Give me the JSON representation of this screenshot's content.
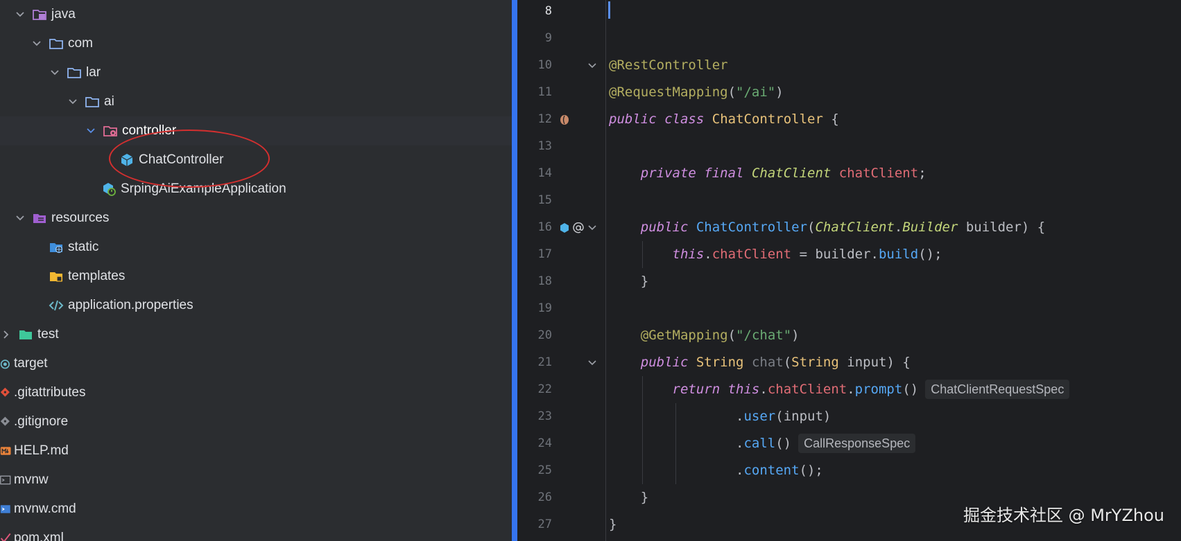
{
  "tree": {
    "items": [
      {
        "label": "java",
        "icon": "java-source-folder-icon",
        "expanded": true
      },
      {
        "label": "com",
        "icon": "package-folder-icon",
        "expanded": true
      },
      {
        "label": "lar",
        "icon": "package-folder-icon",
        "expanded": true
      },
      {
        "label": "ai",
        "icon": "package-folder-icon",
        "expanded": true
      },
      {
        "label": "controller",
        "icon": "controller-package-icon",
        "expanded": true
      },
      {
        "label": "ChatController",
        "icon": "class-icon"
      },
      {
        "label": "SrpingAiExampleApplication",
        "icon": "spring-boot-app-icon"
      },
      {
        "label": "resources",
        "icon": "resources-folder-icon",
        "expanded": true
      },
      {
        "label": "static",
        "icon": "static-folder-icon"
      },
      {
        "label": "templates",
        "icon": "templates-folder-icon"
      },
      {
        "label": "application.properties",
        "icon": "properties-file-icon"
      },
      {
        "label": "test",
        "icon": "test-folder-icon",
        "expanded": false
      },
      {
        "label": "target",
        "icon": "target-folder-icon"
      },
      {
        "label": ".gitattributes",
        "icon": "git-file-icon"
      },
      {
        "label": ".gitignore",
        "icon": "gitignore-file-icon"
      },
      {
        "label": "HELP.md",
        "icon": "markdown-file-icon"
      },
      {
        "label": "mvnw",
        "icon": "shell-script-icon"
      },
      {
        "label": "mvnw.cmd",
        "icon": "cmd-script-icon"
      },
      {
        "label": "pom.xml",
        "icon": "maven-pom-icon"
      }
    ]
  },
  "editor": {
    "line_numbers": [
      "8",
      "9",
      "10",
      "11",
      "12",
      "13",
      "14",
      "15",
      "16",
      "17",
      "18",
      "19",
      "20",
      "21",
      "22",
      "23",
      "24",
      "25",
      "26",
      "27"
    ],
    "current_line": "8",
    "tokens": {
      "rest_controller": "@RestController",
      "request_mapping": "@RequestMapping",
      "ai_path": "\"/ai\"",
      "public": "public",
      "class": "class",
      "chat_controller": "ChatController",
      "private": "private",
      "final": "final",
      "chat_client_type": "ChatClient",
      "chat_client_field": "chatClient",
      "builder_type": "Builder",
      "builder_param": "builder",
      "this": "this",
      "build": "build",
      "get_mapping": "@GetMapping",
      "chat_path": "\"/chat\"",
      "string_type": "String",
      "chat_method": "chat",
      "input_param": "input",
      "return": "return",
      "prompt": "prompt",
      "user": "user",
      "call": "call",
      "content": "content"
    },
    "hints": {
      "prompt_type": "ChatClientRequestSpec",
      "call_type": "CallResponseSpec"
    }
  },
  "watermark": "掘金技术社区 @ MrYZhou",
  "colors": {
    "accent": "#3574f0",
    "annotation_circle": "#d32f2f",
    "keyword": "#cf8ee0",
    "annotation": "#b3ae60",
    "string": "#6aab73",
    "field": "#e06c75",
    "method": "#56a8f5"
  }
}
